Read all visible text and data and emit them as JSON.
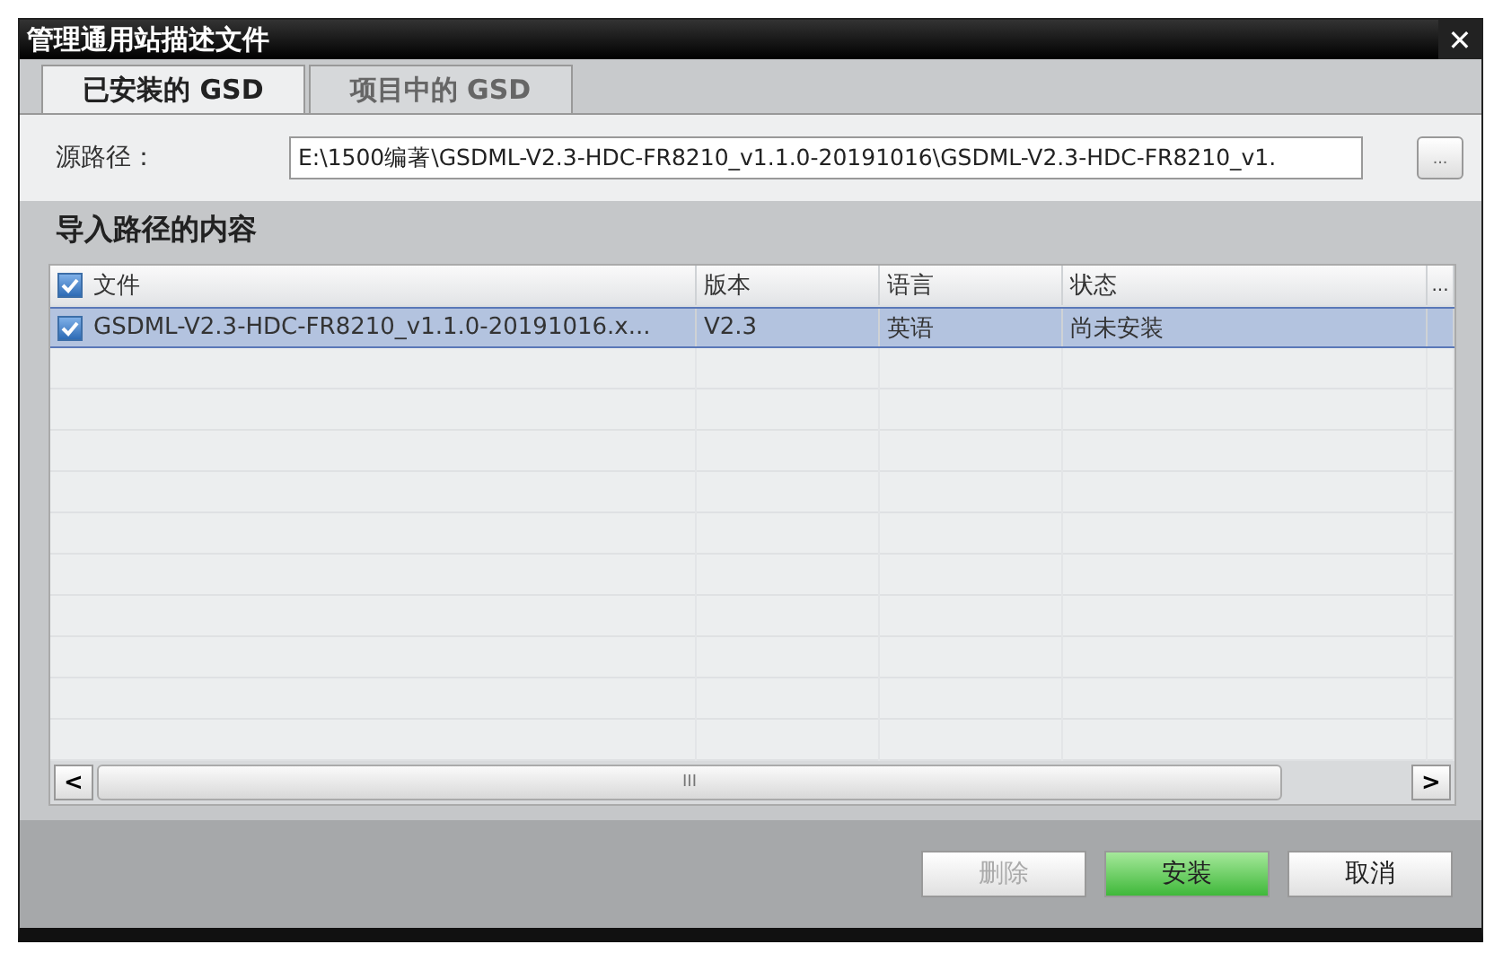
{
  "window": {
    "title": "管理通用站描述文件",
    "close": "✕"
  },
  "tabs": [
    {
      "label": "已安装的 GSD",
      "selected": true
    },
    {
      "label": "项目中的 GSD",
      "selected": false
    }
  ],
  "source": {
    "label": "源路径：",
    "value": "E:\\1500编著\\GSDML-V2.3-HDC-FR8210_v1.1.0-20191016\\GSDML-V2.3-HDC-FR8210_v1.",
    "browse": "..."
  },
  "section": {
    "title": "导入路径的内容"
  },
  "table": {
    "all_checked": true,
    "columns": [
      "文件",
      "版本",
      "语言",
      "状态"
    ],
    "more": "...",
    "rows": [
      {
        "checked": true,
        "selected": true,
        "cells": [
          "GSDML-V2.3-HDC-FR8210_v1.1.0-20191016.x...",
          "V2.3",
          "英语",
          "尚未安装"
        ]
      }
    ],
    "scroll": {
      "left": "<",
      "right": ">",
      "thumb": "III"
    }
  },
  "buttons": [
    {
      "label": "删除",
      "kind": "plain",
      "disabled": true
    },
    {
      "label": "安装",
      "kind": "primary",
      "disabled": false
    },
    {
      "label": "取消",
      "kind": "plain",
      "disabled": false
    }
  ]
}
